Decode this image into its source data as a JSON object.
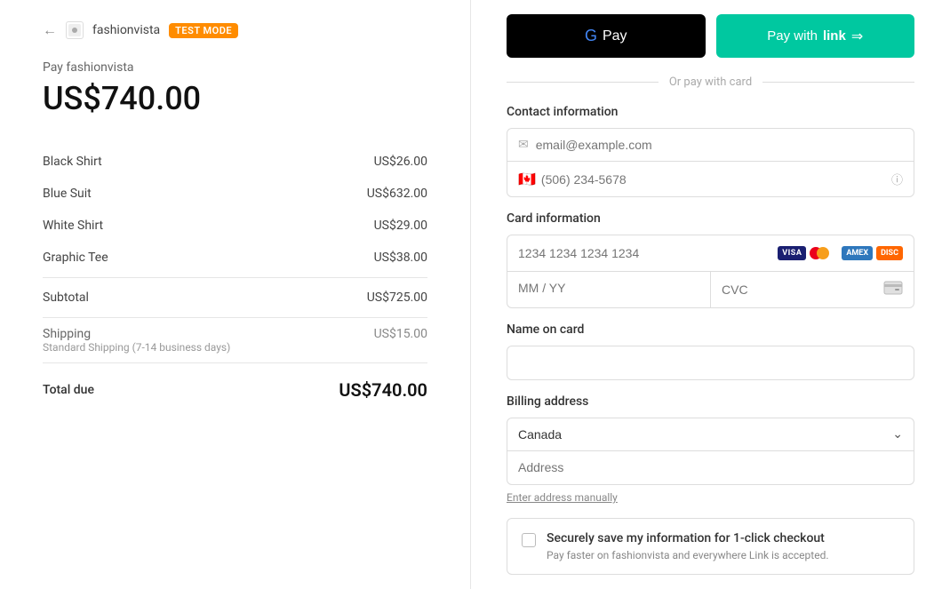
{
  "left": {
    "back_arrow": "←",
    "merchant_name": "fashionvista",
    "test_mode_badge": "TEST MODE",
    "pay_label": "Pay fashionvista",
    "total_amount": "US$740.00",
    "line_items": [
      {
        "name": "Black Shirt",
        "price": "US$26.00"
      },
      {
        "name": "Blue Suit",
        "price": "US$632.00"
      },
      {
        "name": "White Shirt",
        "price": "US$29.00"
      },
      {
        "name": "Graphic Tee",
        "price": "US$38.00"
      }
    ],
    "subtotal_label": "Subtotal",
    "subtotal_value": "US$725.00",
    "shipping_label": "Shipping",
    "shipping_sub": "Standard Shipping (7-14 business days)",
    "shipping_price": "US$15.00",
    "total_label": "Total due",
    "total_value": "US$740.00"
  },
  "right": {
    "gpay_label": "GPay",
    "link_button_prefix": "Pay with",
    "link_button_main": "link",
    "link_arrow": "⇒",
    "or_divider": "Or pay with card",
    "contact_section": "Contact information",
    "email_placeholder": "email@example.com",
    "phone_value": "(506) 234-5678",
    "phone_flag": "🇨🇦",
    "card_section": "Card information",
    "card_number_placeholder": "1234 1234 1234 1234",
    "expiry_placeholder": "MM / YY",
    "cvc_placeholder": "CVC",
    "name_section": "Name on card",
    "name_placeholder": "",
    "billing_section": "Billing address",
    "country_value": "Canada",
    "address_placeholder": "Address",
    "enter_address_link": "Enter address manually",
    "save_title": "Securely save my information for 1-click checkout",
    "save_subtitle": "Pay faster on fashionvista and everywhere Link is accepted."
  }
}
